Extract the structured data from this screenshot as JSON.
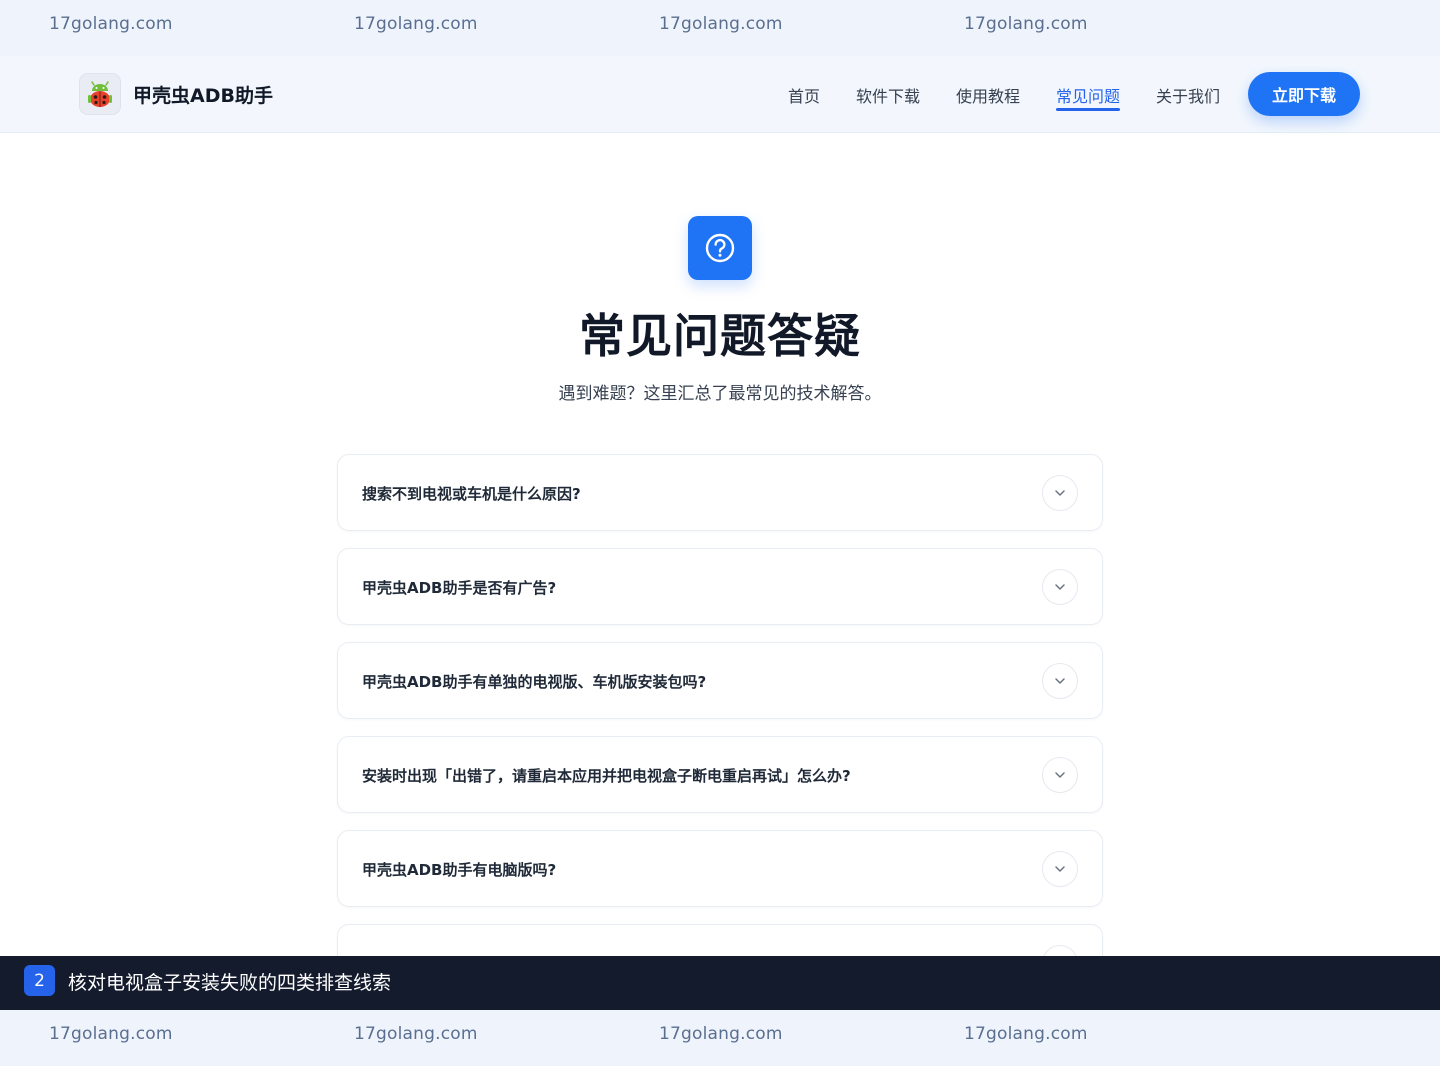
{
  "watermark": {
    "text": "17golang.com",
    "top_items": [
      "17golang.com",
      "17golang.com",
      "17golang.com",
      "17golang.com"
    ],
    "bottom_items": [
      "17golang.com",
      "17golang.com",
      "17golang.com",
      "17golang.com"
    ]
  },
  "header": {
    "brand": "甲壳虫ADB助手",
    "logo_icon": "ladybug-android-icon",
    "nav": [
      {
        "label": "首页",
        "active": false
      },
      {
        "label": "软件下载",
        "active": false
      },
      {
        "label": "使用教程",
        "active": false
      },
      {
        "label": "常见问题",
        "active": true
      },
      {
        "label": "关于我们",
        "active": false
      }
    ],
    "cta_label": "立即下载"
  },
  "hero": {
    "icon": "question-circle-icon",
    "title": "常见问题答疑",
    "subtitle": "遇到难题？这里汇总了最常见的技术解答。"
  },
  "faq": [
    {
      "question": "搜索不到电视或车机是什么原因?"
    },
    {
      "question": "甲壳虫ADB助手是否有广告?"
    },
    {
      "question": "甲壳虫ADB助手有单独的电视版、车机版安装包吗?"
    },
    {
      "question": "安装时出现「出错了，请重启本应用并把电视盒子断电重启再试」怎么办?"
    },
    {
      "question": "甲壳虫ADB助手有电脑版吗?"
    }
  ],
  "caption": {
    "step": "2",
    "text": "核对电视盒子安装失败的四类排查线索"
  },
  "colors": {
    "accent": "#1f73f5",
    "nav_active": "#2563eb",
    "caption_bg": "#141b2d",
    "band_bg": "#eef3fc"
  }
}
